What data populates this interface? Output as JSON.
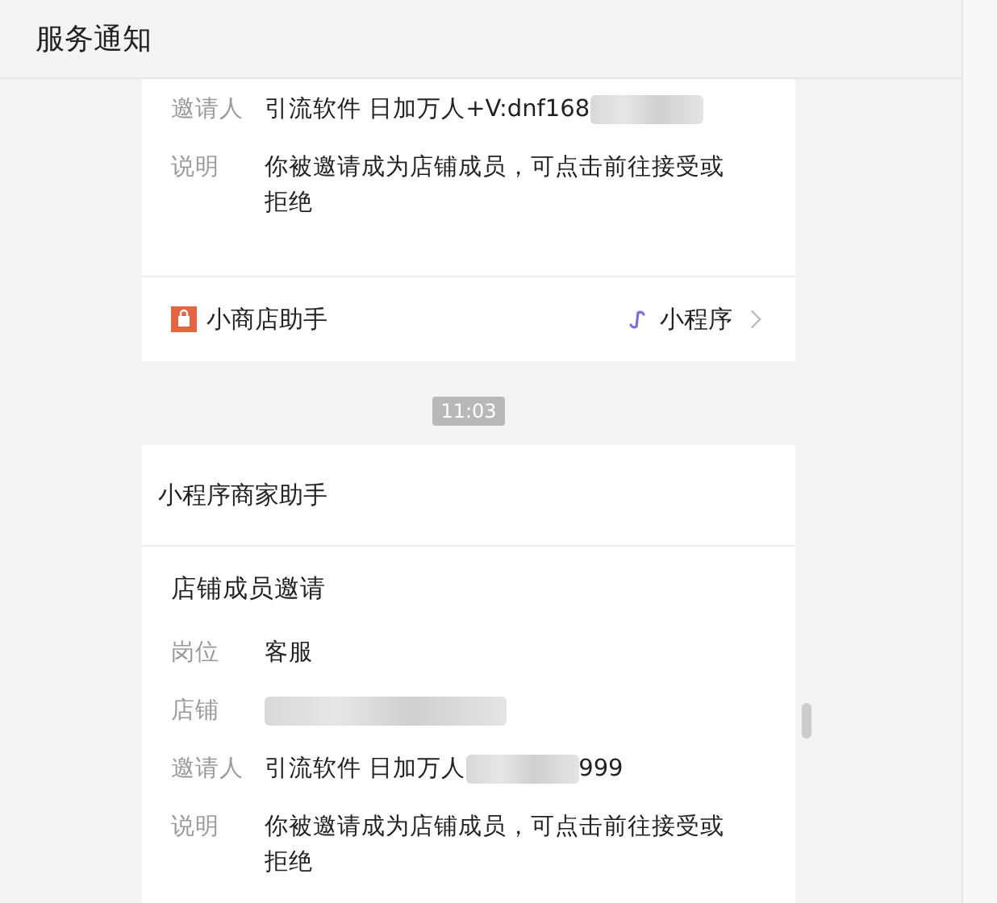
{
  "header": {
    "title": "服务通知"
  },
  "feed": [
    {
      "kind": "card",
      "fields": [
        {
          "label": "邀请人",
          "parts": [
            {
              "kind": "text",
              "text": "引流软件 日加万人+V:dnf168"
            },
            {
              "kind": "blur"
            }
          ]
        },
        {
          "label": "说明",
          "parts": [
            {
              "kind": "text",
              "text": "你被邀请成为店铺成员，可点击前往接受或拒绝"
            }
          ]
        }
      ],
      "footer": {
        "source": "小商店助手",
        "type": "小程序"
      }
    },
    {
      "kind": "time",
      "text": "11:03"
    },
    {
      "kind": "card",
      "header": "小程序商家助手",
      "title": "店铺成员邀请",
      "fields": [
        {
          "label": "岗位",
          "parts": [
            {
              "kind": "text",
              "text": "客服"
            }
          ]
        },
        {
          "label": "店铺",
          "parts": [
            {
              "kind": "blur"
            }
          ]
        },
        {
          "label": "邀请人",
          "parts": [
            {
              "kind": "text",
              "text": "引流软件 日加万人"
            },
            {
              "kind": "blur"
            },
            {
              "kind": "text",
              "text": "999"
            }
          ]
        },
        {
          "label": "说明",
          "parts": [
            {
              "kind": "text",
              "text": "你被邀请成为店铺成员，可点击前往接受或拒绝"
            }
          ]
        }
      ]
    }
  ]
}
